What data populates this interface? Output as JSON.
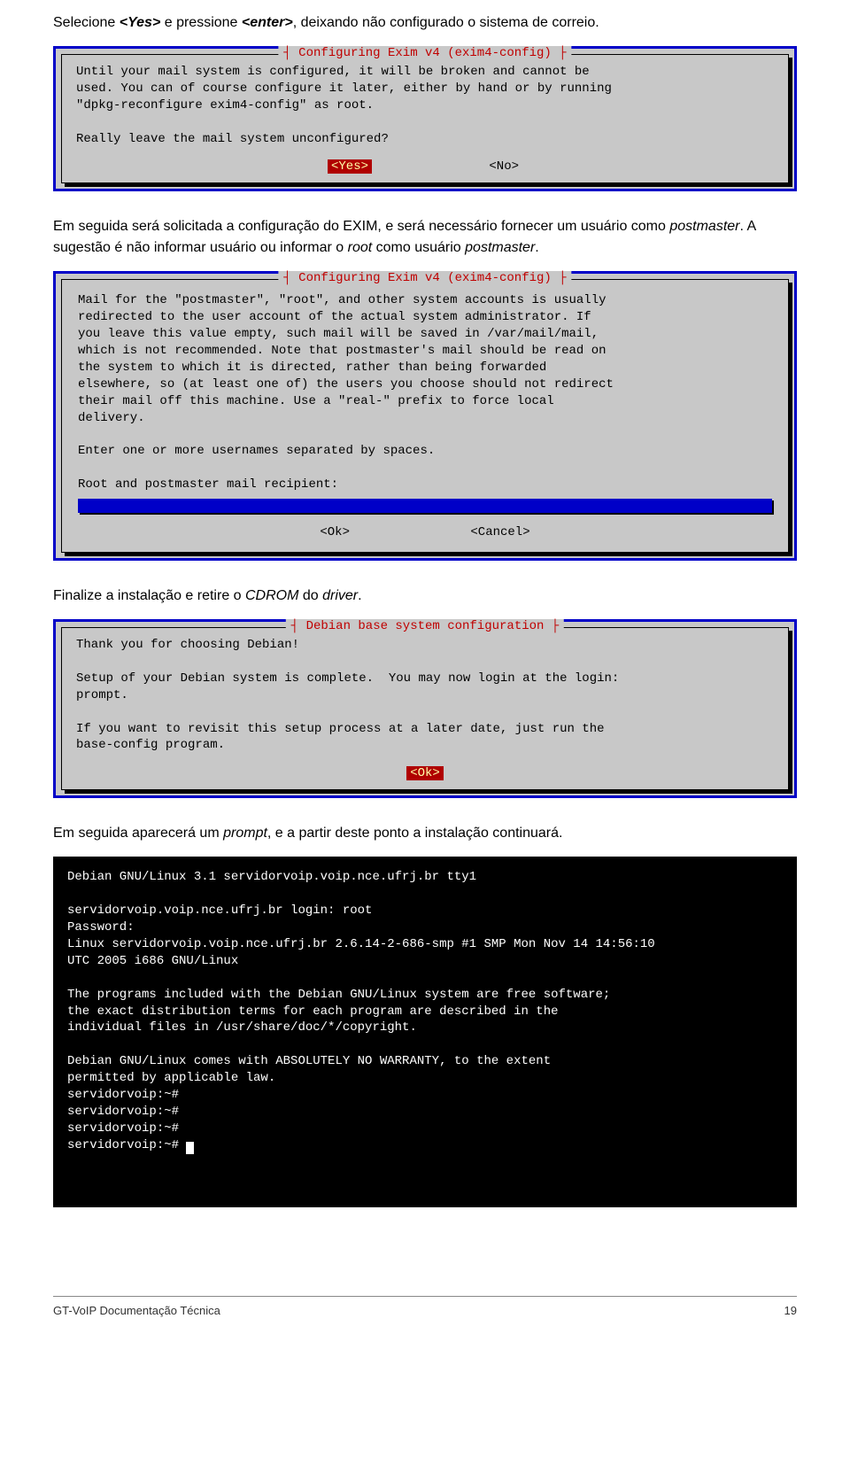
{
  "para1": {
    "p1": "Selecione ",
    "p2": "<Yes>",
    "p3": " e pressione ",
    "p4": "<enter>",
    "p5": ", deixando não configurado o sistema de correio."
  },
  "dialog1": {
    "title": "┤ Configuring Exim v4 (exim4-config) ├",
    "body": "Until your mail system is configured, it will be broken and cannot be\nused. You can of course configure it later, either by hand or by running\n\"dpkg-reconfigure exim4-config\" as root.\n\nReally leave the mail system unconfigured?",
    "yes": "<Yes>",
    "no": "<No>"
  },
  "para2": {
    "p1": "Em seguida será solicitada a configuração do EXIM, e será necessário fornecer um usuário como ",
    "p2": "postmaster",
    "p3": ". A sugestão é não informar usuário ou informar o ",
    "p4": "root",
    "p5": " como usuário ",
    "p6": "postmaster",
    "p7": "."
  },
  "dialog2": {
    "title": "┤ Configuring Exim v4 (exim4-config) ├",
    "body": "Mail for the \"postmaster\", \"root\", and other system accounts is usually\nredirected to the user account of the actual system administrator. If\nyou leave this value empty, such mail will be saved in /var/mail/mail,\nwhich is not recommended. Note that postmaster's mail should be read on\nthe system to which it is directed, rather than being forwarded\nelsewhere, so (at least one of) the users you choose should not redirect\ntheir mail off this machine. Use a \"real-\" prefix to force local\ndelivery.\n\nEnter one or more usernames separated by spaces.\n\nRoot and postmaster mail recipient:",
    "ok": "<Ok>",
    "cancel": "<Cancel>"
  },
  "para3": {
    "p1": "Finalize a instalação e retire o ",
    "p2": "CDROM",
    "p3": " do ",
    "p4": "driver",
    "p5": "."
  },
  "dialog3": {
    "title": "┤ Debian base system configuration ├",
    "body": "Thank you for choosing Debian!\n\nSetup of your Debian system is complete.  You may now login at the login:\nprompt.\n\nIf you want to revisit this setup process at a later date, just run the\nbase-config program.",
    "ok": "<Ok>"
  },
  "para4": {
    "p1": "Em seguida aparecerá um ",
    "p2": "prompt",
    "p3": ", e a partir deste ponto a instalação continuará."
  },
  "terminal": "Debian GNU/Linux 3.1 servidorvoip.voip.nce.ufrj.br tty1\n\nservidorvoip.voip.nce.ufrj.br login: root\nPassword:\nLinux servidorvoip.voip.nce.ufrj.br 2.6.14-2-686-smp #1 SMP Mon Nov 14 14:56:10\nUTC 2005 i686 GNU/Linux\n\nThe programs included with the Debian GNU/Linux system are free software;\nthe exact distribution terms for each program are described in the\nindividual files in /usr/share/doc/*/copyright.\n\nDebian GNU/Linux comes with ABSOLUTELY NO WARRANTY, to the extent\npermitted by applicable law.\nservidorvoip:~#\nservidorvoip:~#\nservidorvoip:~#\nservidorvoip:~# ",
  "footer": {
    "left": "GT-VoIP Documentação Técnica",
    "right": "19"
  }
}
